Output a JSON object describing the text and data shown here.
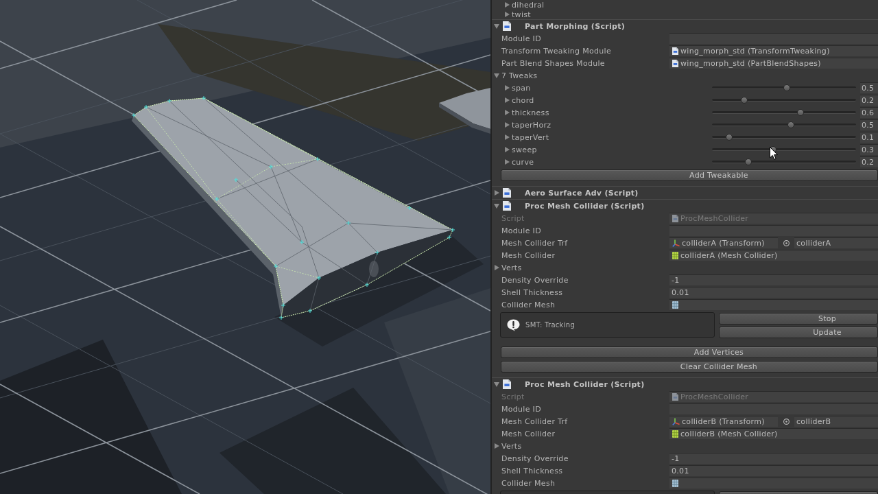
{
  "inspector": {
    "items_above": [
      {
        "label": "dihedral",
        "expanded": false
      },
      {
        "label": "twist",
        "expanded": false
      }
    ],
    "components": [
      {
        "title": "Part Morphing (Script)",
        "expanded": true,
        "fields": [
          {
            "kind": "text",
            "label": "Module ID",
            "disabled": false
          },
          {
            "kind": "asset",
            "label": "Transform Tweaking Module",
            "value": "wing_morph_std (TransformTweaking)",
            "disabled": false
          },
          {
            "kind": "asset",
            "label": "Part Blend Shapes Module",
            "value": "wing_morph_std (PartBlendShapes)",
            "disabled": false
          }
        ],
        "tweaks": {
          "label": "7 Tweaks",
          "expanded": true,
          "items": [
            {
              "label": "span",
              "expanded": false,
              "level": 0.52,
              "reading": "0.5"
            },
            {
              "label": "chord",
              "expanded": false,
              "level": 0.21,
              "reading": "0.2"
            },
            {
              "label": "thickness",
              "expanded": false,
              "level": 0.62,
              "reading": "0.6"
            },
            {
              "label": "taperHorz",
              "expanded": false,
              "level": 0.55,
              "reading": "0.5"
            },
            {
              "label": "taperVert",
              "expanded": false,
              "level": 0.1,
              "reading": "0.1"
            },
            {
              "label": "sweep",
              "expanded": false,
              "level": 0.42,
              "reading": "0.3"
            },
            {
              "label": "curve",
              "expanded": false,
              "level": 0.24,
              "reading": "0.2"
            }
          ]
        },
        "buttons": [
          "Add Tweakable"
        ]
      },
      {
        "title": "Aero Surface Adv (Script)",
        "expanded": false
      },
      {
        "title": "Proc Mesh Collider (Script)",
        "expanded": true,
        "fields": [
          {
            "kind": "asset",
            "label": "Script",
            "value": "ProcMeshCollider",
            "disabled": true
          },
          {
            "kind": "text",
            "label": "Module ID",
            "disabled": false
          },
          {
            "kind": "transform",
            "label": "Mesh Collider Trf",
            "value": "colliderA (Transform)",
            "target": "colliderA",
            "disabled": false
          },
          {
            "kind": "collider",
            "label": "Mesh Collider",
            "value": "colliderA (Mesh Collider)",
            "disabled": false
          },
          {
            "kind": "foldout",
            "label": "Verts",
            "expanded": false,
            "disabled": false
          },
          {
            "kind": "text",
            "label": "Density Override",
            "value": "-1",
            "disabled": false
          },
          {
            "kind": "text",
            "label": "Shell Thickness",
            "value": "0.01",
            "disabled": false
          },
          {
            "kind": "mesh",
            "label": "Collider Mesh",
            "disabled": false
          }
        ],
        "status": {
          "message": "SMT: Tracking",
          "buttons": [
            "Stop",
            "Update"
          ]
        },
        "buttons": [
          "Add Vertices",
          "Clear Collider Mesh"
        ]
      },
      {
        "title": "Proc Mesh Collider (Script)",
        "expanded": true,
        "fields": [
          {
            "kind": "asset",
            "label": "Script",
            "value": "ProcMeshCollider",
            "disabled": true
          },
          {
            "kind": "text",
            "label": "Module ID",
            "disabled": false
          },
          {
            "kind": "transform",
            "label": "Mesh Collider Trf",
            "value": "colliderB (Transform)",
            "target": "colliderB",
            "disabled": false
          },
          {
            "kind": "collider",
            "label": "Mesh Collider",
            "value": "colliderB (Mesh Collider)",
            "disabled": false
          },
          {
            "kind": "foldout",
            "label": "Verts",
            "expanded": false,
            "disabled": false
          },
          {
            "kind": "text",
            "label": "Density Override",
            "value": "-1",
            "disabled": false
          },
          {
            "kind": "text",
            "label": "Shell Thickness",
            "value": "0.01",
            "disabled": false
          },
          {
            "kind": "mesh",
            "label": "Collider Mesh",
            "disabled": false
          }
        ],
        "status": {
          "cut_off": true
        }
      }
    ]
  }
}
